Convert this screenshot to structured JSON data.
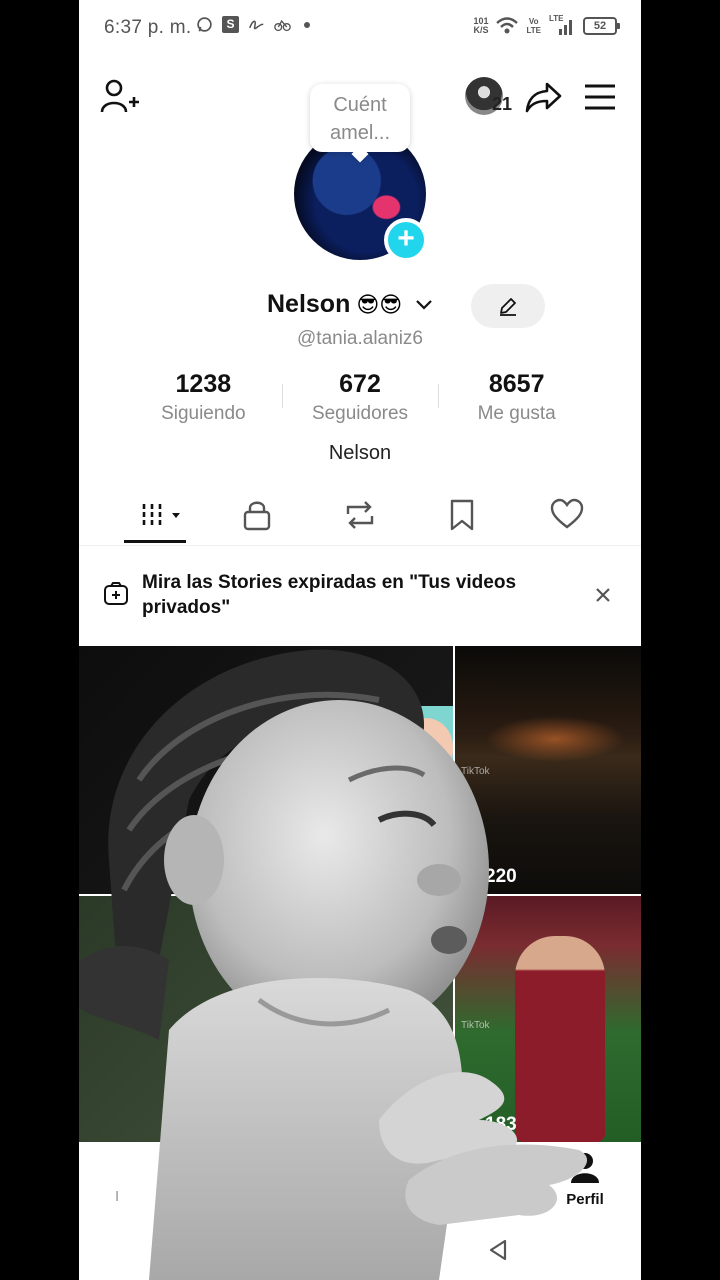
{
  "status_bar": {
    "time": "6:37 p. m.",
    "net_speed_top": "101",
    "net_speed_bottom": "K/S",
    "volte_top": "Vo",
    "volte_bottom": "LTE",
    "lte": "LTE",
    "battery": "52"
  },
  "header": {
    "notification_count": "21",
    "bubble_line1": "Cuént",
    "bubble_line2": "amel..."
  },
  "profile": {
    "display_name": "Nelson",
    "emojis": "😎😎",
    "username": "@tania.alaniz6",
    "bio": "Nelson",
    "stats": [
      {
        "value": "1238",
        "label": "Siguiendo"
      },
      {
        "value": "672",
        "label": "Seguidores"
      },
      {
        "value": "8657",
        "label": "Me gusta"
      }
    ]
  },
  "tabs": [
    {
      "name": "videos-grid",
      "icon": "grid-bars-icon"
    },
    {
      "name": "private",
      "icon": "lock-icon"
    },
    {
      "name": "reposts",
      "icon": "repost-icon"
    },
    {
      "name": "favorites",
      "icon": "bookmark-icon"
    },
    {
      "name": "liked",
      "icon": "heart-icon"
    }
  ],
  "banner": {
    "text": "Mira las Stories expiradas en \"Tus videos privados\""
  },
  "videos": [
    {
      "views": ""
    },
    {
      "views": "220",
      "watermark": "TikTok"
    },
    {
      "views": ""
    },
    {
      "views": "183",
      "watermark": "TikTok"
    }
  ],
  "bottom_nav": {
    "profile_label": "Perfil",
    "left_label": "I"
  },
  "colors": {
    "accent_cyan": "#20d5ec",
    "accent_red": "#fe2c55"
  }
}
